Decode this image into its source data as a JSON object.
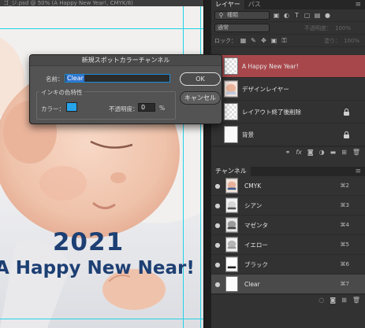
{
  "canvas": {
    "tab_text": "ゴ_ジ.psd @ 50% (A Happy New Year!, CMYK/8)",
    "year_text": "2021",
    "greeting_text": "A Happy New Near!"
  },
  "layers_panel": {
    "tabs": [
      "レイヤー",
      "パス"
    ],
    "menu_icon": "panel-menu-icon",
    "filter_kind": "種類",
    "blend_mode": "通常",
    "opacity_label": "不透明度：",
    "opacity_value": "100%",
    "lock_label": "ロック：",
    "fill_label": "塗り：",
    "fill_value": "100%",
    "layers": [
      {
        "name": "A Happy New Year!",
        "selected": true,
        "visible": false,
        "thumb": "checker",
        "locked": false
      },
      {
        "name": "デザインレイヤー",
        "selected": false,
        "visible": false,
        "thumb": "photo",
        "locked": false
      },
      {
        "name": "レイアウト終了後削除",
        "selected": false,
        "visible": false,
        "thumb": "checker",
        "locked": true
      },
      {
        "name": "背景",
        "selected": false,
        "visible": false,
        "thumb": "white",
        "locked": true
      }
    ],
    "footer_icons": [
      "link-icon",
      "fx-icon",
      "mask-icon",
      "adjustment-icon",
      "folder-icon",
      "new-layer-icon",
      "trash-icon"
    ]
  },
  "channels_panel": {
    "tab": "チャンネル",
    "channels": [
      {
        "name": "CMYK",
        "key": "⌘2",
        "selected": false
      },
      {
        "name": "シアン",
        "key": "⌘3",
        "selected": false
      },
      {
        "name": "マゼンタ",
        "key": "⌘4",
        "selected": false
      },
      {
        "name": "イエロー",
        "key": "⌘5",
        "selected": false
      },
      {
        "name": "ブラック",
        "key": "⌘6",
        "selected": false
      },
      {
        "name": "Clear",
        "key": "⌘7",
        "selected": true
      }
    ],
    "footer_icons": [
      "load-selection-icon",
      "save-selection-icon",
      "new-channel-icon",
      "trash-icon"
    ]
  },
  "dialog": {
    "title": "新規スポットカラーチャンネル",
    "name_label": "名前：",
    "name_value": "Clear",
    "ink_group_label": "インキの色特性",
    "color_label": "カラー：",
    "color_value": "#26a4ec",
    "solidity_label": "不透明度：",
    "solidity_value": "0",
    "solidity_unit": "%",
    "ok_label": "OK",
    "cancel_label": "キャンセル"
  }
}
